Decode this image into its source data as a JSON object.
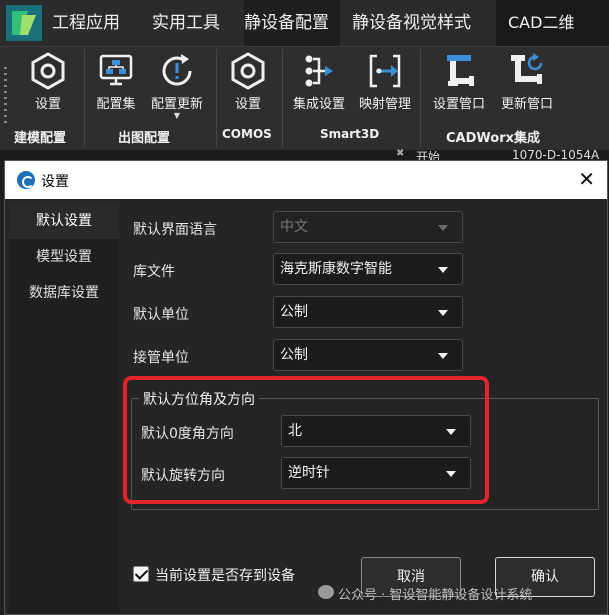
{
  "ribbon_tabs": [
    "工程应用",
    "实用工具",
    "静设备配置",
    "静设备视觉样式",
    "CAD二维"
  ],
  "ribbon_groups": [
    {
      "label": "建模配置",
      "buttons": [
        {
          "label": "设置",
          "icon": "hexagon-nut-icon"
        }
      ]
    },
    {
      "label": "出图配置",
      "buttons": [
        {
          "label": "配置集",
          "icon": "monitor-network-icon"
        },
        {
          "label": "配置更新",
          "icon": "refresh-alert-icon"
        }
      ]
    },
    {
      "label": "COMOS",
      "buttons": [
        {
          "label": "设置",
          "icon": "hexagon-nut-icon"
        }
      ]
    },
    {
      "label": "Smart3D",
      "buttons": [
        {
          "label": "集成设置",
          "icon": "flow-integrate-icon"
        },
        {
          "label": "映射管理",
          "icon": "mapping-arrows-icon"
        }
      ]
    },
    {
      "label": "CADWorx集成",
      "buttons": [
        {
          "label": "设置管口",
          "icon": "pipe-nozzle-icon"
        },
        {
          "label": "更新管口",
          "icon": "pipe-refresh-icon"
        }
      ]
    }
  ],
  "doc_strip": {
    "tab1": "开始",
    "tab2": "1070-D-1054A"
  },
  "dialog": {
    "title": "设置",
    "nav": [
      "默认设置",
      "模型设置",
      "数据库设置"
    ],
    "fields": [
      {
        "label": "默认界面语言",
        "value": "中文",
        "disabled": true
      },
      {
        "label": "库文件",
        "value": "海克斯康数字智能"
      },
      {
        "label": "默认单位",
        "value": "公制"
      },
      {
        "label": "接管单位",
        "value": "公制"
      }
    ],
    "group": {
      "title": "默认方位角及方向",
      "fields": [
        {
          "label": "默认0度角方向",
          "value": "北"
        },
        {
          "label": "默认旋转方向",
          "value": "逆时针"
        }
      ]
    },
    "save_to_device": {
      "label": "当前设置是否存到设备",
      "checked": true
    },
    "cancel_label": "取消",
    "ok_label": "确认"
  },
  "watermark": "公众号 · 智设智能静设备设计系统",
  "colors": {
    "highlight": "#e3242b",
    "logo": "#1e8a5a"
  }
}
